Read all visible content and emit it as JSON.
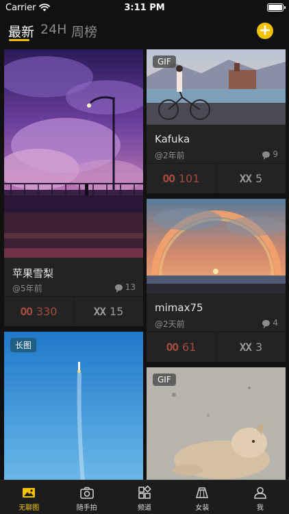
{
  "status_bar": {
    "carrier": "Carrier",
    "time": "3:11 PM"
  },
  "header": {
    "tabs": [
      {
        "label": "最新"
      },
      {
        "label": "24H"
      },
      {
        "label": "周榜"
      }
    ],
    "active_tab": "最新",
    "add_label": "+"
  },
  "feed": {
    "cards": [
      {
        "title": "苹果雪梨",
        "meta": "@5年前",
        "comments": "13",
        "upvote_mark": "OO",
        "upvotes": "330",
        "downvote_mark": "XX",
        "downvotes": "15"
      },
      {
        "badge": "GIF",
        "title": "Kafuka",
        "meta": "@2年前",
        "comments": "9",
        "upvote_mark": "OO",
        "upvotes": "101",
        "downvote_mark": "XX",
        "downvotes": "5"
      },
      {
        "title": "mimax75",
        "meta": "@2天前",
        "comments": "4",
        "upvote_mark": "OO",
        "upvotes": "61",
        "downvote_mark": "XX",
        "downvotes": "3"
      },
      {
        "badge": "长图"
      },
      {
        "badge": "GIF"
      }
    ]
  },
  "tabbar": {
    "items": [
      {
        "label": "无聊图",
        "icon": "picture-icon"
      },
      {
        "label": "随手拍",
        "icon": "camera-icon"
      },
      {
        "label": "频道",
        "icon": "grid-icon"
      },
      {
        "label": "女装",
        "icon": "skirt-icon"
      },
      {
        "label": "我",
        "icon": "person-icon"
      }
    ],
    "active": "无聊图"
  },
  "colors": {
    "accent": "#f2c200",
    "upvote": "#a24b3e",
    "background": "#111111",
    "card": "#232323"
  }
}
